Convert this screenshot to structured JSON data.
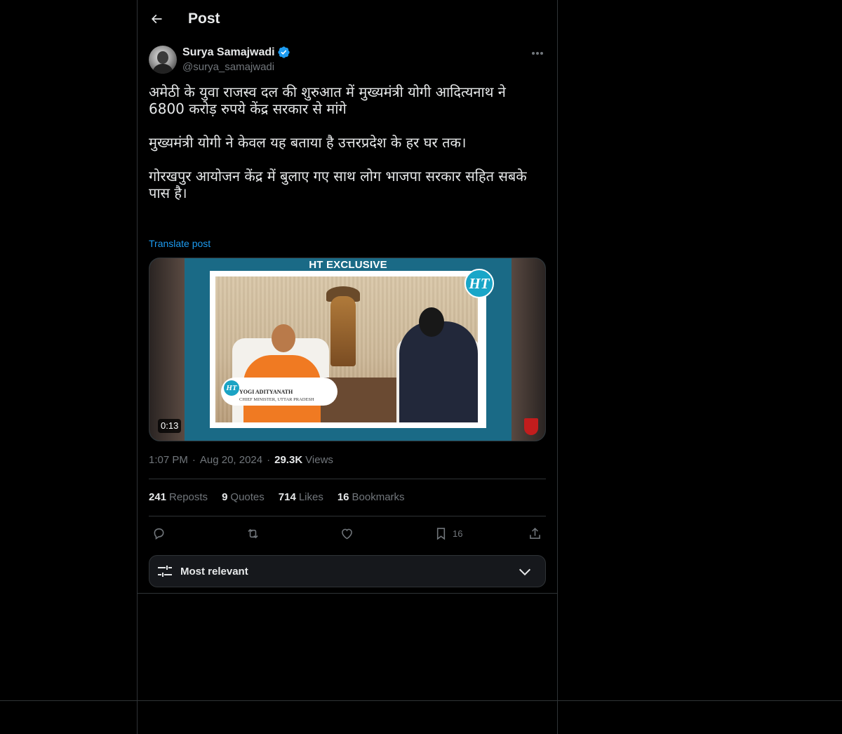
{
  "header": {
    "title": "Post"
  },
  "author": {
    "name": "Surya Samajwadi",
    "handle": "@surya_samajwadi",
    "verified": true
  },
  "post": {
    "text": "अमेठी के युवा राजस्व दल की शुरुआत में मुख्यमंत्री योगी आदित्यनाथ ने 6800 करोड़ रुपये केंद्र सरकार से मांगे\n\nमुख्यमंत्री योगी ने केवल यह बताया है उत्तरप्रदेश के हर घर तक।\n\nगोरखपुर आयोजन केंद्र में बुलाए गए साथ लोग भाजपा सरकार सहित सबके पास है।",
    "translate_label": "Translate post"
  },
  "media": {
    "banner": "HT EXCLUSIVE",
    "logo_text": "HT",
    "caption_name": "YOGI ADITYANATH",
    "caption_role": "CHIEF MINISTER, UTTAR PRADESH",
    "duration": "0:13"
  },
  "meta": {
    "time": "1:07 PM",
    "date": "Aug 20, 2024",
    "views_count": "29.3K",
    "views_label": "Views"
  },
  "stats": [
    {
      "count": "241",
      "label": "Reposts"
    },
    {
      "count": "9",
      "label": "Quotes"
    },
    {
      "count": "714",
      "label": "Likes"
    },
    {
      "count": "16",
      "label": "Bookmarks"
    }
  ],
  "actions": {
    "bookmark_count": "16"
  },
  "sort": {
    "label": "Most relevant"
  },
  "colors": {
    "accent": "#1d9bf0",
    "background": "#000000",
    "border": "#2f3336",
    "muted": "#71767b"
  }
}
